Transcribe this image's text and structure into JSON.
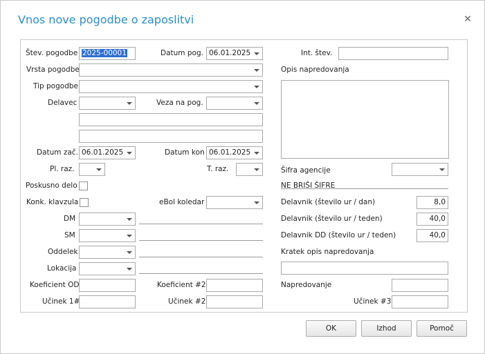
{
  "window": {
    "title": "Vnos nove pogodbe o zaposlitvi"
  },
  "fields": {
    "stev_pogodbe": {
      "label": "Štev. pogodbe",
      "value": "2025-00001"
    },
    "datum_pog": {
      "label": "Datum pog.",
      "value": "06.01.2025"
    },
    "int_stev": {
      "label": "Int. štev.",
      "value": ""
    },
    "vrsta_pogodbe": {
      "label": "Vrsta pogodbe",
      "value": ""
    },
    "opis_napredovanja": {
      "label": "Opis napredovanja",
      "value": ""
    },
    "tip_pogodbe": {
      "label": "Tip pogodbe",
      "value": ""
    },
    "delavec": {
      "label": "Delavec",
      "value": ""
    },
    "veza_na_pog": {
      "label": "Veza na pog.",
      "value": ""
    },
    "datum_zac": {
      "label": "Datum zač.",
      "value": "06.01.2025"
    },
    "datum_kon": {
      "label": "Datum kon",
      "value": "06.01.2025"
    },
    "pl_raz": {
      "label": "Pl. raz.",
      "value": ""
    },
    "t_raz": {
      "label": "T. raz.",
      "value": ""
    },
    "sifra_agencije": {
      "label": "Šifra agencije",
      "value": ""
    },
    "poskusno_delo": {
      "label": "Poskusno delo"
    },
    "ne_brisi_sifre": {
      "label": "NE BRIŠI ŠIFRE"
    },
    "konk_klavzula": {
      "label": "Konk. klavzula"
    },
    "ebol_koledar": {
      "label": "eBol koledar",
      "value": ""
    },
    "delavnik_dan": {
      "label": "Delavnik (število ur / dan)",
      "value": "8,0"
    },
    "dm": {
      "label": "DM",
      "value": ""
    },
    "delavnik_teden": {
      "label": "Delavnik (število ur / teden)",
      "value": "40,0"
    },
    "sm": {
      "label": "SM",
      "value": ""
    },
    "delavnik_dd_teden": {
      "label": "Delavnik DD (število ur / teden)",
      "value": "40,0"
    },
    "oddelek": {
      "label": "Oddelek",
      "value": ""
    },
    "kratek_opis": {
      "label": "Kratek opis napredovanja",
      "value": ""
    },
    "lokacija": {
      "label": "Lokacija",
      "value": ""
    },
    "koeficient_od": {
      "label": "Koeficient OD",
      "value": ""
    },
    "koeficient_2": {
      "label": "Koeficient #2",
      "value": ""
    },
    "napredovanje": {
      "label": "Napredovanje",
      "value": ""
    },
    "ucinek_1": {
      "label": "Učinek 1#",
      "value": ""
    },
    "ucinek_2": {
      "label": "Učinek #2",
      "value": ""
    },
    "ucinek_3": {
      "label": "Učinek #3",
      "value": ""
    }
  },
  "buttons": {
    "ok": "OK",
    "izhod": "Izhod",
    "pomoc": "Pomoč"
  }
}
